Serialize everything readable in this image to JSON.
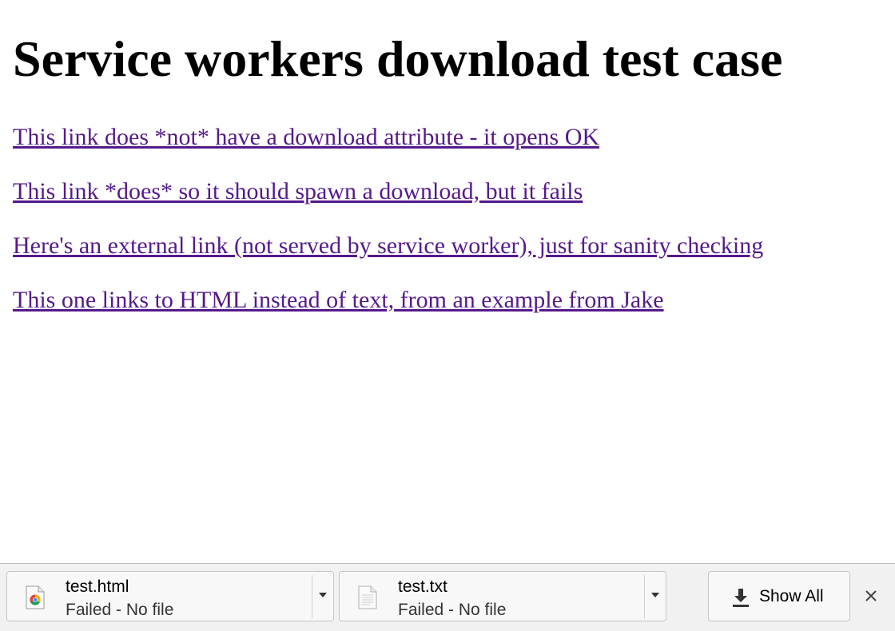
{
  "page": {
    "title": "Service workers download test case",
    "links": [
      {
        "label": "This link does *not* have a download attribute - it opens OK"
      },
      {
        "label": "This link *does* so it should spawn a download, but it fails"
      },
      {
        "label": "Here's an external link (not served by service worker), just for sanity checking"
      },
      {
        "label": "This one links to HTML instead of text, from an example from Jake"
      }
    ],
    "link_color": "#551a8b"
  },
  "download_shelf": {
    "items": [
      {
        "filename": "test.html",
        "status": "Failed - No file",
        "icon": "chrome-file-icon"
      },
      {
        "filename": "test.txt",
        "status": "Failed - No file",
        "icon": "text-file-icon"
      }
    ],
    "show_all_label": "Show All",
    "show_all_icon": "download-arrow-icon",
    "close_icon": "close-icon"
  }
}
